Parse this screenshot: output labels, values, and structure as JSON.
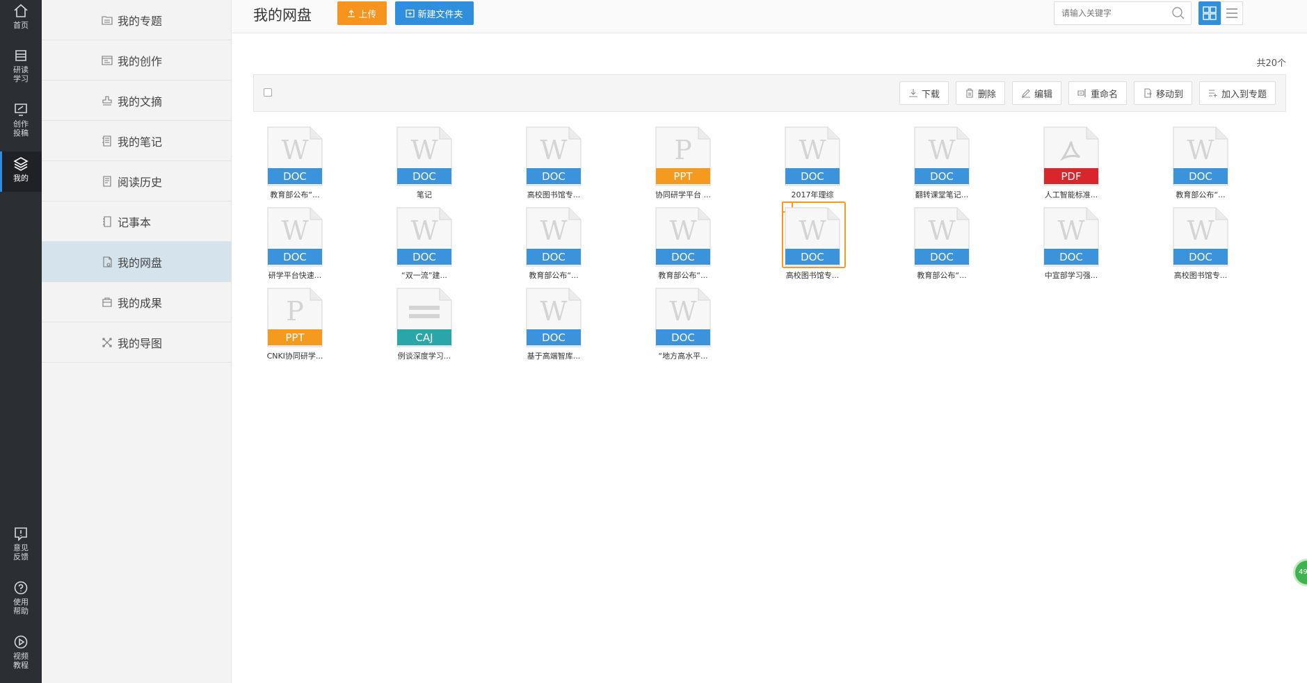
{
  "rail": {
    "items": [
      {
        "label": "首页",
        "icon": "home-icon"
      },
      {
        "label": "研读\n学习",
        "icon": "book-stack-icon"
      },
      {
        "label": "创作\n投稿",
        "icon": "monitor-pen-icon"
      },
      {
        "label": "我的",
        "icon": "layers-icon",
        "active": true
      }
    ],
    "bottom": [
      {
        "label": "意见\n反馈",
        "icon": "feedback-icon"
      },
      {
        "label": "使用\n帮助",
        "icon": "help-icon"
      },
      {
        "label": "视频\n教程",
        "icon": "play-icon"
      }
    ]
  },
  "subnav": {
    "items": [
      {
        "label": "我的专题",
        "icon": "folder-list-icon"
      },
      {
        "label": "我的创作",
        "icon": "creation-icon"
      },
      {
        "label": "我的文摘",
        "icon": "stamp-icon"
      },
      {
        "label": "我的笔记",
        "icon": "notes-icon"
      },
      {
        "label": "阅读历史",
        "icon": "history-icon"
      },
      {
        "label": "记事本",
        "icon": "notebook-icon"
      },
      {
        "label": "我的网盘",
        "icon": "cloud-disk-icon",
        "active": true
      },
      {
        "label": "我的成果",
        "icon": "achievement-icon"
      },
      {
        "label": "我的导图",
        "icon": "mindmap-icon"
      }
    ]
  },
  "header": {
    "title": "我的网盘",
    "upload_label": "上传",
    "new_folder_label": "新建文件夹",
    "search_placeholder": "请输入关键字"
  },
  "count_label": "共20个",
  "toolbar": {
    "buttons": [
      {
        "label": "下载",
        "icon": "download-icon"
      },
      {
        "label": "删除",
        "icon": "trash-icon"
      },
      {
        "label": "编辑",
        "icon": "edit-icon"
      },
      {
        "label": "重命名",
        "icon": "rename-icon"
      },
      {
        "label": "移动到",
        "icon": "move-icon"
      },
      {
        "label": "加入到专题",
        "icon": "add-topic-icon"
      }
    ]
  },
  "colors": {
    "DOC": "#3b93dc",
    "PPT": "#f39a1f",
    "PDF": "#d9262d",
    "CAJ": "#2ba6a8",
    "selected_border": "#f39a1f"
  },
  "files": [
    {
      "type": "DOC",
      "name": "教育部公布“..."
    },
    {
      "type": "DOC",
      "name": "笔记"
    },
    {
      "type": "DOC",
      "name": "高校图书馆专..."
    },
    {
      "type": "PPT",
      "name": "协同研学平台 ..."
    },
    {
      "type": "DOC",
      "name": "2017年理综"
    },
    {
      "type": "DOC",
      "name": "翻转课堂笔记..."
    },
    {
      "type": "PDF",
      "name": "人工智能标准..."
    },
    {
      "type": "DOC",
      "name": "教育部公布“..."
    },
    {
      "type": "DOC",
      "name": "研学平台快速..."
    },
    {
      "type": "DOC",
      "name": "“双一流”建..."
    },
    {
      "type": "DOC",
      "name": "教育部公布“..."
    },
    {
      "type": "DOC",
      "name": "教育部公布“..."
    },
    {
      "type": "DOC",
      "name": "高校图书馆专...",
      "selected": true
    },
    {
      "type": "DOC",
      "name": "教育部公布“..."
    },
    {
      "type": "DOC",
      "name": "中宣部学习强..."
    },
    {
      "type": "DOC",
      "name": "高校图书馆专..."
    },
    {
      "type": "PPT",
      "name": "CNKI协同研学..."
    },
    {
      "type": "CAJ",
      "name": "例谈深度学习..."
    },
    {
      "type": "DOC",
      "name": "基于高端智库..."
    },
    {
      "type": "DOC",
      "name": "“地方高水平..."
    }
  ],
  "float_badge": "49"
}
